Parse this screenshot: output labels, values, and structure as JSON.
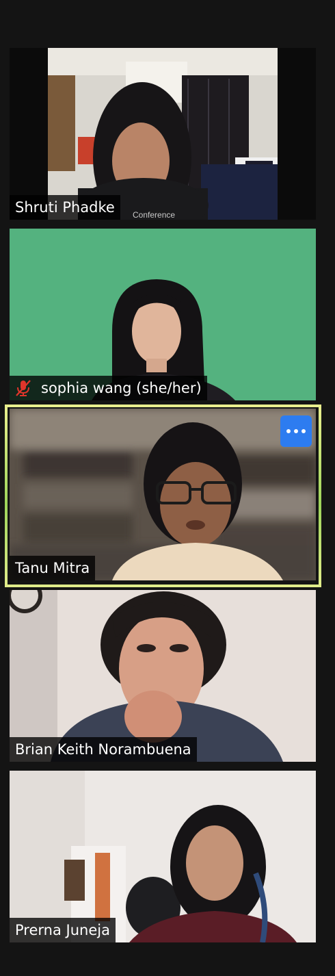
{
  "participants": [
    {
      "name": "Shruti Phadke",
      "muted": false,
      "active_speaker": false
    },
    {
      "name": "sophia wang (she/her)",
      "muted": true,
      "active_speaker": false
    },
    {
      "name": "Tanu Mitra",
      "muted": false,
      "active_speaker": true
    },
    {
      "name": "Brian Keith Norambuena",
      "muted": false,
      "active_speaker": false
    },
    {
      "name": "Prerna Juneja",
      "muted": false,
      "active_speaker": false
    }
  ],
  "colors": {
    "background": "#141414",
    "active_speaker_border": "#c8e05a",
    "more_button": "#2d7cf0",
    "muted_icon": "#e0352b",
    "green_screen": "#54b27f"
  },
  "icons": {
    "mute": "microphone-muted-icon",
    "more": "more-options-icon"
  }
}
